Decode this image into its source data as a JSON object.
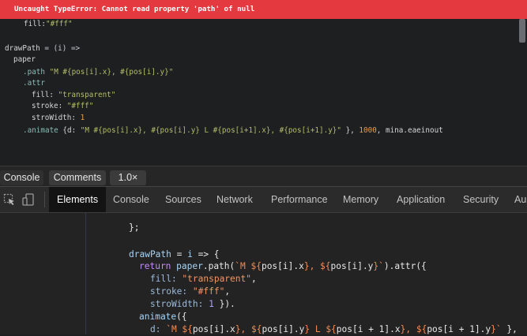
{
  "error": {
    "message": "Uncaught TypeError: Cannot read property 'path' of null"
  },
  "editor": {
    "lines": [
      [
        {
          "t": "fill:",
          "c": "def"
        },
        {
          "t": "\"#fff\"",
          "c": "str"
        }
      ],
      [],
      [
        {
          "t": "drawPath",
          "c": "def"
        },
        {
          "t": " = (i) =>",
          "c": "arrow"
        }
      ],
      [
        {
          "t": "paper",
          "c": "def"
        }
      ],
      [
        {
          "t": ".path ",
          "c": "kw"
        },
        {
          "t": "\"M #{pos[i].x}, #{pos[i].y}\"",
          "c": "str"
        }
      ],
      [
        {
          "t": ".attr",
          "c": "kw"
        }
      ],
      [
        {
          "t": "fill: ",
          "c": "def"
        },
        {
          "t": "\"transparent\"",
          "c": "str"
        }
      ],
      [
        {
          "t": "stroke: ",
          "c": "def"
        },
        {
          "t": "\"#fff\"",
          "c": "str"
        }
      ],
      [
        {
          "t": "stroWidth: ",
          "c": "def"
        },
        {
          "t": "1",
          "c": "num"
        }
      ],
      [
        {
          "t": ".animate ",
          "c": "kw"
        },
        {
          "t": "{d: ",
          "c": "def"
        },
        {
          "t": "\"M #{pos[i].x}, #{pos[i].y} L #{pos[i+1].x}, #{pos[i+1].y}\"",
          "c": "str"
        },
        {
          "t": " }, ",
          "c": "def"
        },
        {
          "t": "1000",
          "c": "num"
        },
        {
          "t": ", mina.",
          "c": "def"
        },
        {
          "t": "eaeinout",
          "c": "def"
        }
      ]
    ]
  },
  "bottombar": {
    "console_label": "Console",
    "comments_label": "Comments",
    "zoom_label": "1.0×"
  },
  "devtools": {
    "tabs": [
      "Elements",
      "Console",
      "Sources",
      "Network",
      "Performance",
      "Memory",
      "Application",
      "Security",
      "Au"
    ],
    "active_tab": "Elements",
    "source_lines": [
      [
        {
          "t": "};",
          "c": "def"
        }
      ],
      [],
      [
        {
          "t": "drawPath",
          "c": "var"
        },
        {
          "t": " = ",
          "c": "def"
        },
        {
          "t": "i",
          "c": "var"
        },
        {
          "t": " => {",
          "c": "def"
        }
      ],
      [
        {
          "t": "return ",
          "c": "kw"
        },
        {
          "t": "paper",
          "c": "var"
        },
        {
          "t": ".path(",
          "c": "def"
        },
        {
          "t": "`M ${",
          "c": "tpl"
        },
        {
          "t": "pos[i].x",
          "c": "def"
        },
        {
          "t": "}, ${",
          "c": "tpl"
        },
        {
          "t": "pos[i].y",
          "c": "def"
        },
        {
          "t": "}`",
          "c": "tpl"
        },
        {
          "t": ").attr({",
          "c": "def"
        }
      ],
      [
        {
          "t": "fill: ",
          "c": "prop"
        },
        {
          "t": "\"transparent\"",
          "c": "str"
        },
        {
          "t": ",",
          "c": "def"
        }
      ],
      [
        {
          "t": "stroke: ",
          "c": "prop"
        },
        {
          "t": "\"#fff\"",
          "c": "str"
        },
        {
          "t": ",",
          "c": "def"
        }
      ],
      [
        {
          "t": "stroWidth: ",
          "c": "prop"
        },
        {
          "t": "1",
          "c": "num"
        },
        {
          "t": " }).",
          "c": "def"
        }
      ],
      [
        {
          "t": "animate",
          "c": "var"
        },
        {
          "t": "({",
          "c": "def"
        }
      ],
      [
        {
          "t": "d: ",
          "c": "prop"
        },
        {
          "t": "`M ${",
          "c": "tpl"
        },
        {
          "t": "pos[i].x",
          "c": "def"
        },
        {
          "t": "}, ${",
          "c": "tpl"
        },
        {
          "t": "pos[i].y",
          "c": "def"
        },
        {
          "t": "} L ${",
          "c": "tpl"
        },
        {
          "t": "pos[i + 1].x",
          "c": "def"
        },
        {
          "t": "}, ${",
          "c": "tpl"
        },
        {
          "t": "pos[i + 1].y",
          "c": "def"
        },
        {
          "t": "}` ",
          "c": "tpl"
        },
        {
          "t": "},",
          "c": "def"
        }
      ]
    ]
  },
  "colors": {
    "error_banner": "#e4393f",
    "editor_bg": "#1d1f21",
    "devtools_bg": "#242424",
    "active_tab_bg": "#131313"
  },
  "icons": {
    "inspect": "cursor-select-icon",
    "device": "device-toolbar-icon"
  }
}
